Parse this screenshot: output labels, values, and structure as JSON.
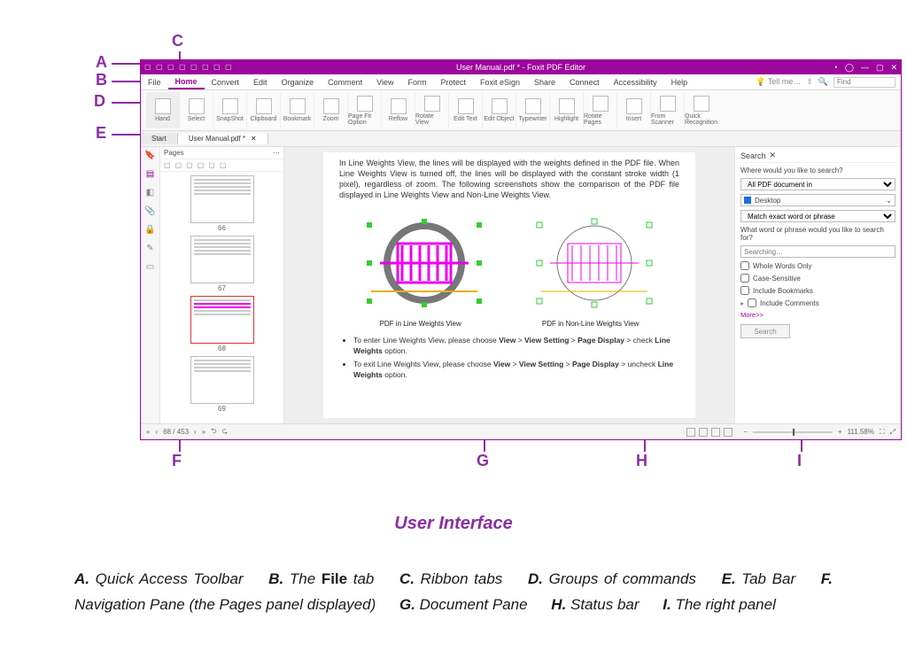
{
  "callouts": {
    "A": "A",
    "B": "B",
    "C": "C",
    "D": "D",
    "E": "E",
    "F": "F",
    "G": "G",
    "H": "H",
    "I": "I"
  },
  "titlebar": {
    "title": "User Manual.pdf * - Foxit PDF Editor"
  },
  "ribbon": {
    "tabs": [
      "File",
      "Home",
      "Convert",
      "Edit",
      "Organize",
      "Comment",
      "View",
      "Form",
      "Protect",
      "Foxit eSign",
      "Share",
      "Connect",
      "Accessibility",
      "Help"
    ],
    "active": "Home",
    "tell_me": "Tell me…",
    "find_placeholder": "Find",
    "groups": [
      "Hand",
      "Select",
      "SnapShot",
      "Clipboard",
      "Bookmark",
      "Zoom",
      "Page Fit Option",
      "Reflow",
      "Rotate View",
      "Edit Text",
      "Edit Object",
      "Typewriter",
      "Highlight",
      "Rotate Pages",
      "Insert",
      "From Scanner",
      "Quick Recognition"
    ]
  },
  "tabbar": {
    "tabs": [
      {
        "label": "Start"
      },
      {
        "label": "User Manual.pdf *",
        "active": true,
        "closable": true
      }
    ]
  },
  "pages_panel": {
    "title": "Pages",
    "thumbs": [
      {
        "num": "66"
      },
      {
        "num": "67"
      },
      {
        "num": "68",
        "selected": true
      },
      {
        "num": "69"
      }
    ]
  },
  "document": {
    "para1": "In Line Weights View, the lines will be displayed with the weights defined in the PDF file. When Line Weights View is turned off, the lines will be displayed with the constant stroke width (1 pixel), regardless of zoom. The following screenshots show the comparison of the PDF file displayed in Line Weights View and Non-Line Weights View.",
    "fig1_label": "PDF in Line Weights View",
    "fig2_label": "PDF in Non-Line Weights View",
    "li1a": "To enter Line Weights View, please choose ",
    "li1b": "View",
    "li1c": " > ",
    "li1d": "View Setting",
    "li1e": " > ",
    "li1f": "Page Display",
    "li1g": " > check ",
    "li1h": "Line Weights",
    "li1i": " option.",
    "li2a": "To exit Line Weights View, please choose ",
    "li2g": " > uncheck "
  },
  "search": {
    "tab": "Search",
    "q1": "Where would you like to search?",
    "sel1": "All PDF document in",
    "sel2": "Desktop",
    "sel3": "Match exact word or phrase",
    "q2": "What word or phrase would you like to search for?",
    "placeholder": "Searching…",
    "chk1": "Whole Words Only",
    "chk2": "Case-Sensitive",
    "chk3": "Include Bookmarks",
    "chk4": "Include Comments",
    "more": "More>>",
    "btn": "Search"
  },
  "status": {
    "page_field": "68 / 453",
    "zoom": "111.58%"
  },
  "caption": "User Interface",
  "legend": {
    "A": "Quick Access Toolbar",
    "B_pre": "The ",
    "B_b": "File",
    "B_post": " tab",
    "C": "Ribbon tabs",
    "D": "Groups of commands",
    "E": "Tab Bar",
    "F": "Navigation Pane (the Pages panel displayed)",
    "G": "Document Pane",
    "H": "Status bar",
    "I": "The right panel"
  }
}
